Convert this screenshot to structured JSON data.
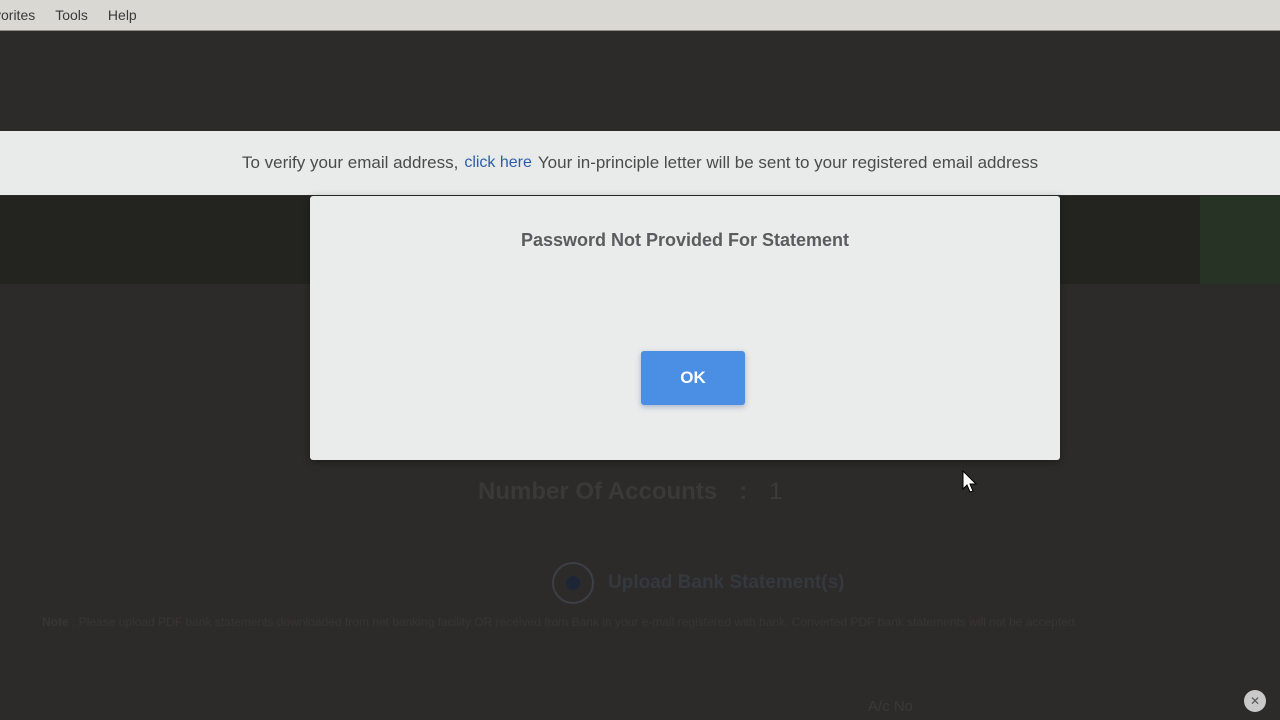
{
  "menubar": {
    "items": [
      "vorites",
      "Tools",
      "Help"
    ]
  },
  "banner": {
    "prefix": "To verify your email address,",
    "link": "click here",
    "suffix": "Your in-principle letter will be sent to your registered email address"
  },
  "modal": {
    "message": "Password Not Provided For Statement",
    "ok_label": "OK"
  },
  "background": {
    "accounts_label": "Number Of Accounts",
    "accounts_sep": ":",
    "accounts_value": "1",
    "upload_label": "Upload Bank Statement(s)",
    "note_label": "Note",
    "note_text": ": Please upload PDF bank statements downloaded from net banking facility OR received from Bank in your e-mail registered with bank. Converted PDF bank statements will not be accepted.",
    "acno_label": "A/c No"
  },
  "colors": {
    "ok_button": "#4a8fe4",
    "link": "#2c5ea8",
    "modal_bg": "#eaebeb"
  },
  "icons": {
    "cursor": "mouse-pointer-icon",
    "close": "close-icon"
  }
}
